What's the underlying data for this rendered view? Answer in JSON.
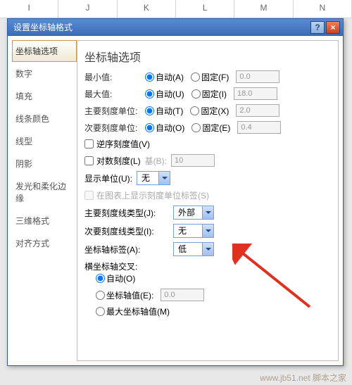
{
  "excel_cols": [
    "I",
    "J",
    "K",
    "L",
    "M",
    "N"
  ],
  "titlebar": {
    "title": "设置坐标轴格式",
    "help": "?",
    "close": "×"
  },
  "sidebar": {
    "items": [
      {
        "label": "坐标轴选项",
        "active": true
      },
      {
        "label": "数字"
      },
      {
        "label": "填充"
      },
      {
        "label": "线条颜色"
      },
      {
        "label": "线型"
      },
      {
        "label": "阴影"
      },
      {
        "label": "发光和柔化边缘"
      },
      {
        "label": "三维格式"
      },
      {
        "label": "对齐方式"
      }
    ]
  },
  "panel": {
    "heading": "坐标轴选项",
    "min": {
      "label": "最小值:",
      "auto": "自动(A)",
      "fixed": "固定(F)",
      "val": "0.0"
    },
    "max": {
      "label": "最大值:",
      "auto": "自动(U)",
      "fixed": "固定(I)",
      "val": "18.0"
    },
    "major": {
      "label": "主要刻度单位:",
      "auto": "自动(T)",
      "fixed": "固定(X)",
      "val": "2.0"
    },
    "minor": {
      "label": "次要刻度单位:",
      "auto": "自动(O)",
      "fixed": "固定(E)",
      "val": "0.4"
    },
    "rev": {
      "label": "逆序刻度值(V)"
    },
    "log": {
      "label": "对数刻度(L)",
      "base_lbl": "基(B):",
      "base_val": "10"
    },
    "disp_unit": {
      "label": "显示单位(U):",
      "value": "无"
    },
    "show_disp_label": {
      "label": "在图表上显示刻度单位标签(S)"
    },
    "major_tick": {
      "label": "主要刻度线类型(J):",
      "value": "外部"
    },
    "minor_tick": {
      "label": "次要刻度线类型(I):",
      "value": "无"
    },
    "axis_label": {
      "label": "坐标轴标签(A):",
      "value": "低"
    },
    "cross": {
      "heading": "横坐标轴交叉:",
      "auto": "自动(O)",
      "at_val": "坐标轴值(E):",
      "at_val_num": "0.0",
      "max": "最大坐标轴值(M)"
    }
  },
  "watermark": "www.jb51.net 脚本之家"
}
